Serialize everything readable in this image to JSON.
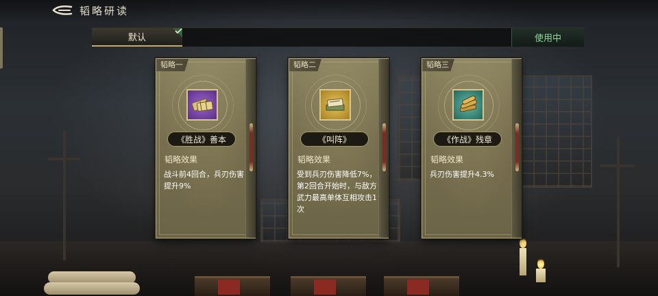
{
  "header": {
    "title": "韬略研读"
  },
  "tabs": {
    "default_label": "默认",
    "status_label": "使用中"
  },
  "cards": [
    {
      "slot": "韬略一",
      "name": "《胜战》善本",
      "effect_title": "韬略效果",
      "effect_text": "战斗前4回合，兵刃伤害提升9%",
      "icon": "bound-scroll-icon",
      "color": "#7a4aa6"
    },
    {
      "slot": "韬略二",
      "name": "《叫阵》",
      "effect_title": "韬略效果",
      "effect_text": "受到兵刃伤害降低7%，第2回合开始时，与敌方武力最高单体互相攻击1次",
      "icon": "book-stack-icon",
      "color": "#c9a23a"
    },
    {
      "slot": "韬略三",
      "name": "《作战》残章",
      "effect_title": "韬略效果",
      "effect_text": "兵刃伤害提升4.3%",
      "icon": "bamboo-scroll-icon",
      "color": "#3e8c7c"
    }
  ]
}
